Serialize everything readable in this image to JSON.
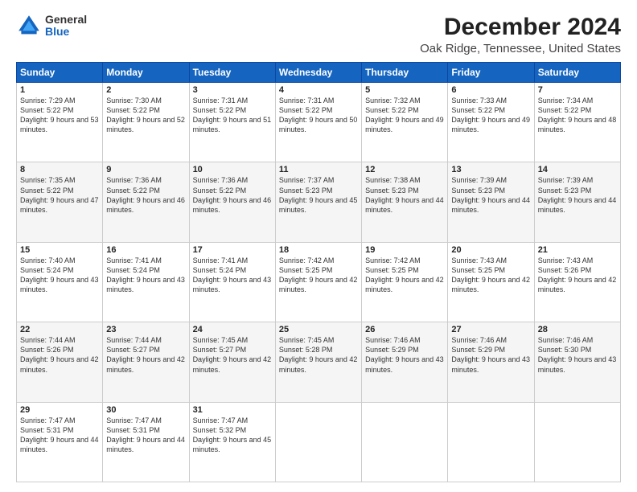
{
  "logo": {
    "general": "General",
    "blue": "Blue"
  },
  "title": "December 2024",
  "subtitle": "Oak Ridge, Tennessee, United States",
  "days_header": [
    "Sunday",
    "Monday",
    "Tuesday",
    "Wednesday",
    "Thursday",
    "Friday",
    "Saturday"
  ],
  "weeks": [
    [
      {
        "day": "1",
        "sunrise": "7:29 AM",
        "sunset": "5:22 PM",
        "daylight": "9 hours and 53 minutes."
      },
      {
        "day": "2",
        "sunrise": "7:30 AM",
        "sunset": "5:22 PM",
        "daylight": "9 hours and 52 minutes."
      },
      {
        "day": "3",
        "sunrise": "7:31 AM",
        "sunset": "5:22 PM",
        "daylight": "9 hours and 51 minutes."
      },
      {
        "day": "4",
        "sunrise": "7:31 AM",
        "sunset": "5:22 PM",
        "daylight": "9 hours and 50 minutes."
      },
      {
        "day": "5",
        "sunrise": "7:32 AM",
        "sunset": "5:22 PM",
        "daylight": "9 hours and 49 minutes."
      },
      {
        "day": "6",
        "sunrise": "7:33 AM",
        "sunset": "5:22 PM",
        "daylight": "9 hours and 49 minutes."
      },
      {
        "day": "7",
        "sunrise": "7:34 AM",
        "sunset": "5:22 PM",
        "daylight": "9 hours and 48 minutes."
      }
    ],
    [
      {
        "day": "8",
        "sunrise": "7:35 AM",
        "sunset": "5:22 PM",
        "daylight": "9 hours and 47 minutes."
      },
      {
        "day": "9",
        "sunrise": "7:36 AM",
        "sunset": "5:22 PM",
        "daylight": "9 hours and 46 minutes."
      },
      {
        "day": "10",
        "sunrise": "7:36 AM",
        "sunset": "5:22 PM",
        "daylight": "9 hours and 46 minutes."
      },
      {
        "day": "11",
        "sunrise": "7:37 AM",
        "sunset": "5:23 PM",
        "daylight": "9 hours and 45 minutes."
      },
      {
        "day": "12",
        "sunrise": "7:38 AM",
        "sunset": "5:23 PM",
        "daylight": "9 hours and 44 minutes."
      },
      {
        "day": "13",
        "sunrise": "7:39 AM",
        "sunset": "5:23 PM",
        "daylight": "9 hours and 44 minutes."
      },
      {
        "day": "14",
        "sunrise": "7:39 AM",
        "sunset": "5:23 PM",
        "daylight": "9 hours and 44 minutes."
      }
    ],
    [
      {
        "day": "15",
        "sunrise": "7:40 AM",
        "sunset": "5:24 PM",
        "daylight": "9 hours and 43 minutes."
      },
      {
        "day": "16",
        "sunrise": "7:41 AM",
        "sunset": "5:24 PM",
        "daylight": "9 hours and 43 minutes."
      },
      {
        "day": "17",
        "sunrise": "7:41 AM",
        "sunset": "5:24 PM",
        "daylight": "9 hours and 43 minutes."
      },
      {
        "day": "18",
        "sunrise": "7:42 AM",
        "sunset": "5:25 PM",
        "daylight": "9 hours and 42 minutes."
      },
      {
        "day": "19",
        "sunrise": "7:42 AM",
        "sunset": "5:25 PM",
        "daylight": "9 hours and 42 minutes."
      },
      {
        "day": "20",
        "sunrise": "7:43 AM",
        "sunset": "5:25 PM",
        "daylight": "9 hours and 42 minutes."
      },
      {
        "day": "21",
        "sunrise": "7:43 AM",
        "sunset": "5:26 PM",
        "daylight": "9 hours and 42 minutes."
      }
    ],
    [
      {
        "day": "22",
        "sunrise": "7:44 AM",
        "sunset": "5:26 PM",
        "daylight": "9 hours and 42 minutes."
      },
      {
        "day": "23",
        "sunrise": "7:44 AM",
        "sunset": "5:27 PM",
        "daylight": "9 hours and 42 minutes."
      },
      {
        "day": "24",
        "sunrise": "7:45 AM",
        "sunset": "5:27 PM",
        "daylight": "9 hours and 42 minutes."
      },
      {
        "day": "25",
        "sunrise": "7:45 AM",
        "sunset": "5:28 PM",
        "daylight": "9 hours and 42 minutes."
      },
      {
        "day": "26",
        "sunrise": "7:46 AM",
        "sunset": "5:29 PM",
        "daylight": "9 hours and 43 minutes."
      },
      {
        "day": "27",
        "sunrise": "7:46 AM",
        "sunset": "5:29 PM",
        "daylight": "9 hours and 43 minutes."
      },
      {
        "day": "28",
        "sunrise": "7:46 AM",
        "sunset": "5:30 PM",
        "daylight": "9 hours and 43 minutes."
      }
    ],
    [
      {
        "day": "29",
        "sunrise": "7:47 AM",
        "sunset": "5:31 PM",
        "daylight": "9 hours and 44 minutes."
      },
      {
        "day": "30",
        "sunrise": "7:47 AM",
        "sunset": "5:31 PM",
        "daylight": "9 hours and 44 minutes."
      },
      {
        "day": "31",
        "sunrise": "7:47 AM",
        "sunset": "5:32 PM",
        "daylight": "9 hours and 45 minutes."
      },
      null,
      null,
      null,
      null
    ]
  ],
  "labels": {
    "sunrise": "Sunrise:",
    "sunset": "Sunset:",
    "daylight": "Daylight:"
  }
}
